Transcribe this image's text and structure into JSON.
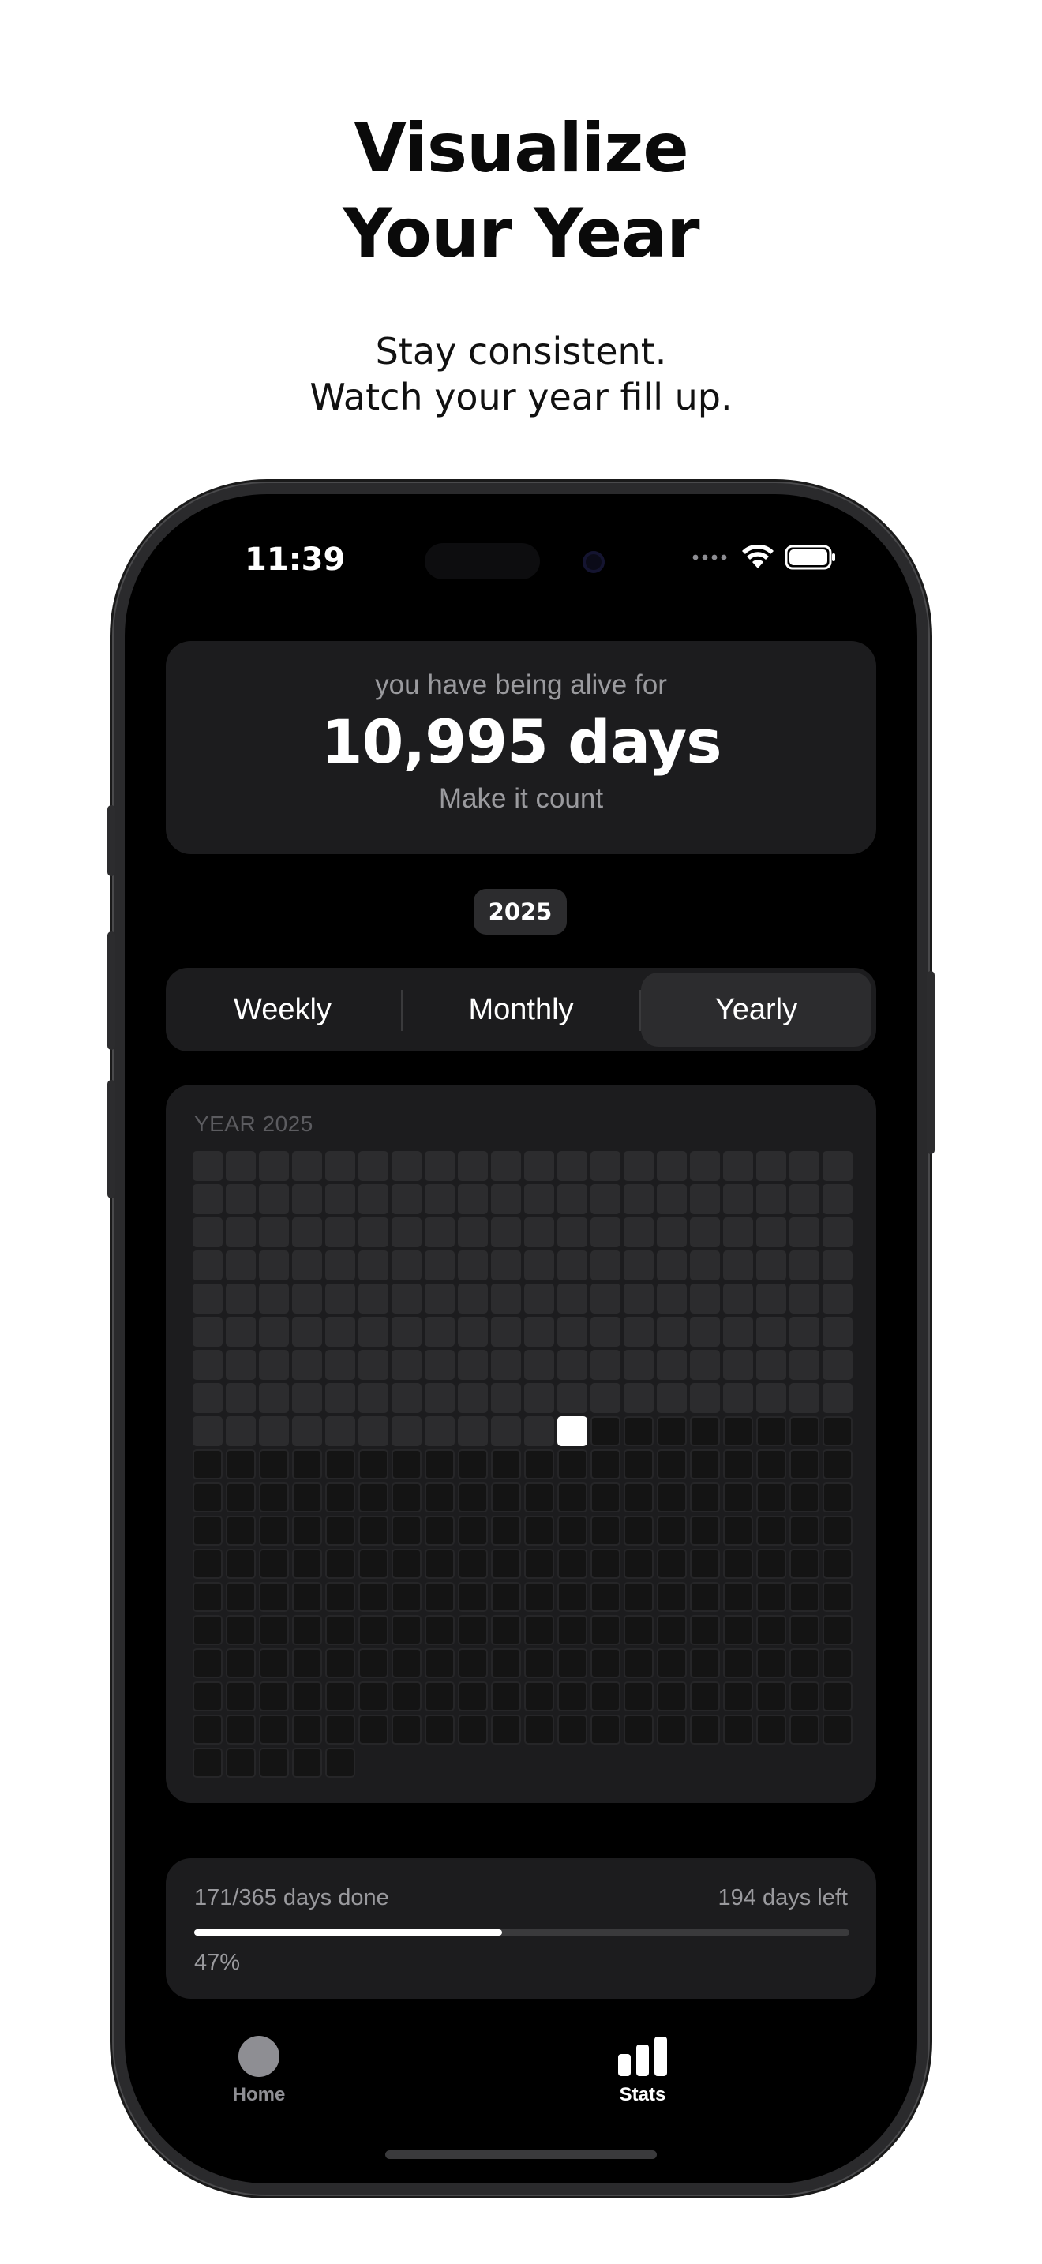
{
  "promo": {
    "title_line1": "Visualize",
    "title_line2": "Your Year",
    "subtitle_line1": "Stay consistent.",
    "subtitle_line2": "Watch your year fill up."
  },
  "status_bar": {
    "time": "11:39"
  },
  "alive_card": {
    "caption": "you have being alive for",
    "days": "10,995 days",
    "footer": "Make it count"
  },
  "year_badge": "2025",
  "segmented": {
    "options": [
      "Weekly",
      "Monthly",
      "Yearly"
    ],
    "selected": "Yearly"
  },
  "year_grid": {
    "label": "YEAR 2025",
    "total_days": 365,
    "days_done": 171,
    "today_index": 171,
    "columns": 20
  },
  "progress": {
    "done_text": "171/365 days done",
    "left_text": "194 days left",
    "percent_text": "47%",
    "fraction": 0.47
  },
  "tabbar": {
    "home_label": "Home",
    "stats_label": "Stats",
    "selected": "Stats"
  },
  "colors": {
    "accent": "#ffffff",
    "card": "#1c1c1e",
    "cell_done": "#2c2c2e",
    "cell_todo": "#141414"
  }
}
